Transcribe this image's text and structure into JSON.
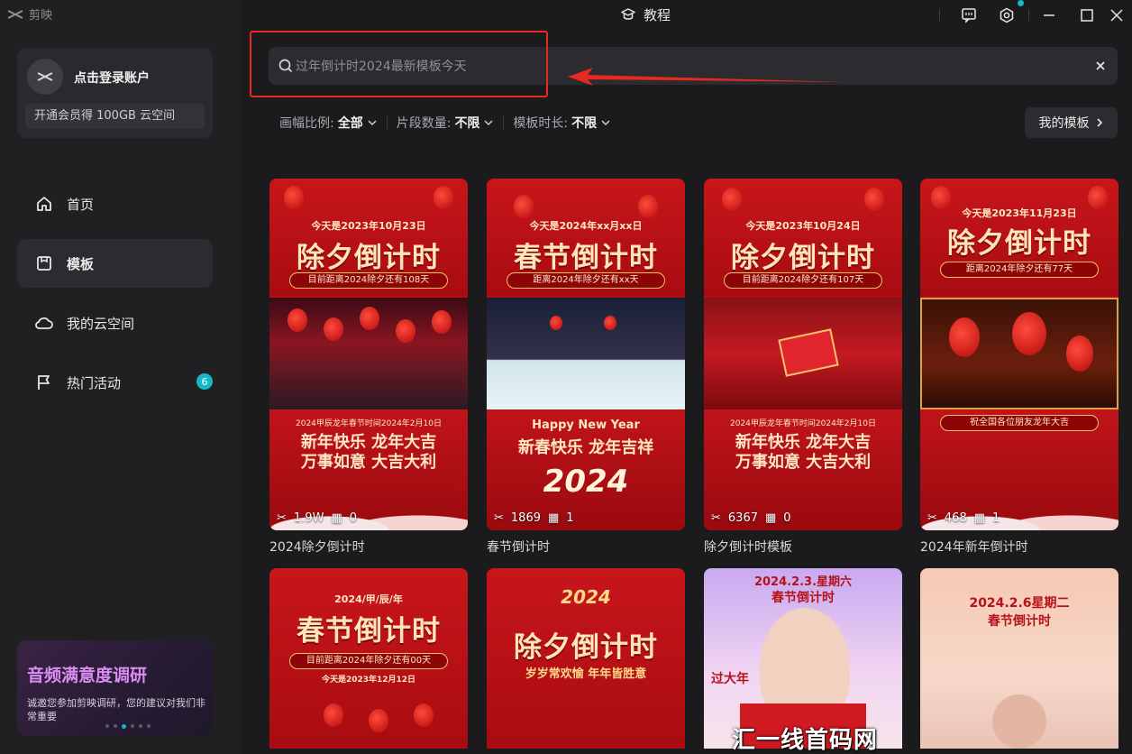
{
  "app": {
    "name": "剪映"
  },
  "account": {
    "login_label": "点击登录账户",
    "vip_promo": "开通会员得 100GB 云空间"
  },
  "nav": [
    {
      "label": "首页",
      "icon": "home-icon"
    },
    {
      "label": "模板",
      "icon": "template-icon",
      "active": true
    },
    {
      "label": "我的云空间",
      "icon": "cloud-icon"
    },
    {
      "label": "热门活动",
      "icon": "flag-icon",
      "badge": "6"
    }
  ],
  "survey": {
    "title": "音频满意度调研",
    "text": "诚邀您参加剪映调研，您的建议对我们非常重要"
  },
  "topbar": {
    "tutorial_label": "教程"
  },
  "search": {
    "placeholder": "过年倒计时2024最新模板今天"
  },
  "filters": [
    {
      "label": "画幅比例:",
      "value": "全部"
    },
    {
      "label": "片段数量:",
      "value": "不限"
    },
    {
      "label": "模板时长:",
      "value": "不限"
    }
  ],
  "my_templates_label": "我的模板",
  "cards": [
    {
      "title": "2024除夕倒计时",
      "uses": "1.9W",
      "clips": "0",
      "date_line": "今天是2023年10月23日",
      "big_title": "除夕倒计时",
      "ribbon": "目前距离2024除夕还有108天",
      "wish_date": "2024甲辰龙年春节时间2024年2月10日",
      "wish1": "新年快乐 龙年大吉",
      "wish2": "万事如意 大吉大利"
    },
    {
      "title": "春节倒计时",
      "uses": "1869",
      "clips": "1",
      "date_line": "今天是2024年xx月xx日",
      "big_title": "春节倒计时",
      "ribbon": "距离2024年除夕还有xx天",
      "wish_date": "Happy New Year",
      "wish1": "新春快乐 龙年吉祥",
      "wish2": "2024"
    },
    {
      "title": "除夕倒计时模板",
      "uses": "6367",
      "clips": "0",
      "date_line": "今天是2023年10月24日",
      "big_title": "除夕倒计时",
      "ribbon": "目前距离2024除夕还有107天",
      "wish_date": "2024甲辰龙年春节时间2024年2月10日",
      "wish1": "新年快乐 龙年大吉",
      "wish2": "万事如意 大吉大利"
    },
    {
      "title": "2024年新年倒计时",
      "uses": "468",
      "clips": "1",
      "date_line": "今天是2023年11月23日",
      "big_title": "除夕倒计时",
      "ribbon": "距离2024年除夕还有77天",
      "wish_date": "",
      "wish1": "祝全国各位朋友龙年大吉",
      "wish2": ""
    }
  ],
  "cards_row2": [
    {
      "top_line": "2024/甲/辰/年",
      "big_title": "春节倒计时",
      "ribbon": "目前距离2024年除夕还有00天",
      "sub": "今天是2023年12月12日"
    },
    {
      "top_line": "2024",
      "big_title": "除夕倒计时",
      "ribbon": "岁岁常欢愉 年年皆胜意",
      "sub": ""
    },
    {
      "top_line": "2024.2.3.星期六",
      "big_title": "春节倒计时",
      "ribbon": "过大年",
      "sub": ""
    },
    {
      "top_line": "2024.2.6星期二",
      "big_title": "春节倒计时",
      "ribbon": "",
      "sub": ""
    }
  ],
  "watermark": "汇一线首码网 www.huiyixian.com",
  "colors": {
    "accent": "#17b7c9",
    "annotation": "#e8291f",
    "festive_red": "#c8161b"
  }
}
